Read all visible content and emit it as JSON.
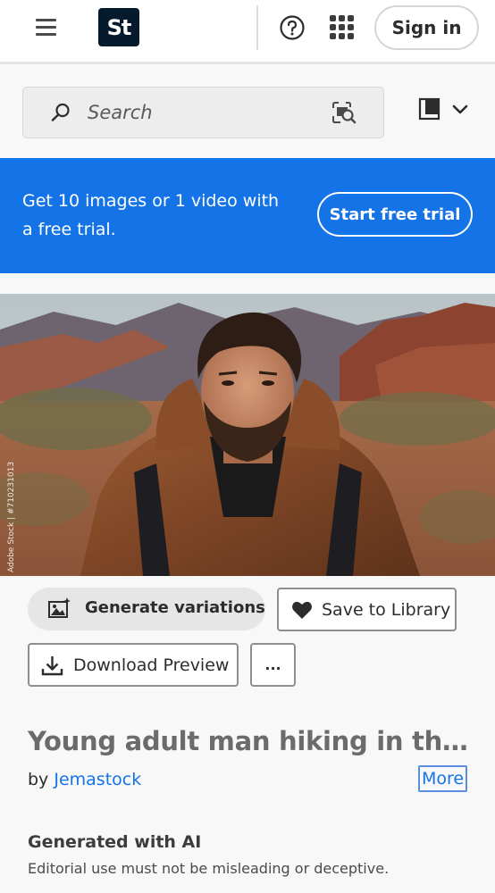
{
  "header": {
    "logo_text": "St",
    "signin_label": "Sign in"
  },
  "search": {
    "placeholder": "Search"
  },
  "promo": {
    "text": "Get 10 images or 1 video with a free trial.",
    "button_label": "Start free trial"
  },
  "asset": {
    "watermark": "Adobe Stock | #710231013",
    "title": "Young adult man hiking in the wilderness",
    "by_prefix": "by",
    "author": "Jemastock",
    "more_label": "More"
  },
  "actions": {
    "generate_label": "Generate variations",
    "save_label": "Save to Library",
    "download_label": "Download Preview",
    "more_label": "..."
  },
  "ai_info": {
    "heading": "Generated with AI",
    "note": "Editorial use must not be misleading or deceptive."
  },
  "colors": {
    "promo_bg": "#1473e6",
    "link": "#1473e6",
    "logo_bg": "#061a2e"
  },
  "icons": [
    "menu-icon",
    "help-icon",
    "apps-grid-icon",
    "search-icon",
    "visual-search-icon",
    "collections-icon",
    "chevron-down-icon",
    "generate-variations-icon",
    "heart-icon",
    "download-icon"
  ]
}
